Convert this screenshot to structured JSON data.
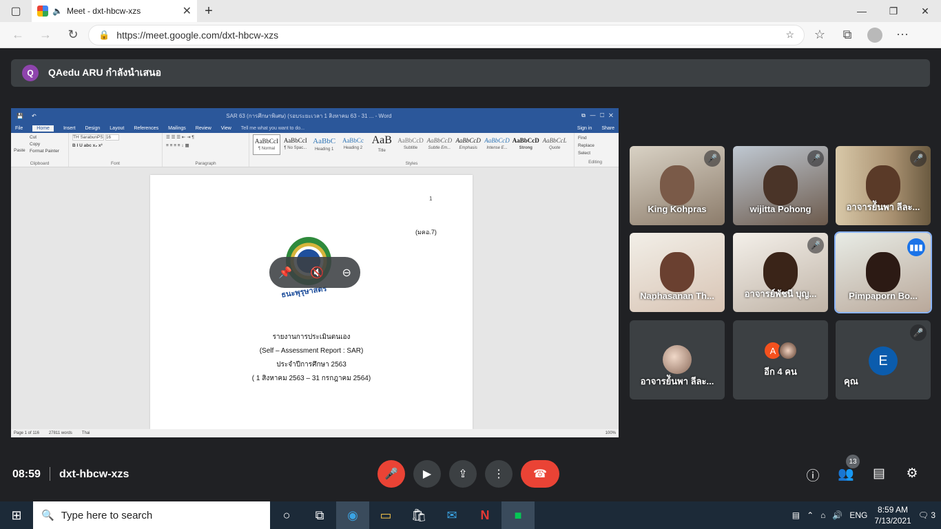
{
  "browser": {
    "tab_title": "Meet - dxt-hbcw-xzs",
    "url": "https://meet.google.com/dxt-hbcw-xzs"
  },
  "banner": {
    "avatar_letter": "Q",
    "text": "QAedu ARU กำลังนำเสนอ"
  },
  "word": {
    "title": "SAR 63 (การศึกษาพิเศษ) (รอบระยะเวลา 1 สิงหาคม 63 - 31 ... - Word",
    "tabs": [
      "File",
      "Home",
      "Insert",
      "Design",
      "Layout",
      "References",
      "Mailings",
      "Review",
      "View"
    ],
    "tell_me": "Tell me what you want to do...",
    "sign_in": "Sign in",
    "share": "Share",
    "clipboard": {
      "paste": "Paste",
      "cut": "Cut",
      "copy": "Copy",
      "format_painter": "Format Painter",
      "label": "Clipboard"
    },
    "font": {
      "name": "TH SarabunPS",
      "size": "16",
      "label": "Font"
    },
    "paragraph_label": "Paragraph",
    "styles": [
      {
        "preview": "AaBbCcI",
        "name": "¶ Normal"
      },
      {
        "preview": "AaBbCcI",
        "name": "¶ No Spac..."
      },
      {
        "preview": "AaBbC",
        "name": "Heading 1"
      },
      {
        "preview": "AaBbCc",
        "name": "Heading 2"
      },
      {
        "preview": "AaB",
        "name": "Title"
      },
      {
        "preview": "AaBbCcD",
        "name": "Subtitle"
      },
      {
        "preview": "AaBbCcD",
        "name": "Subtle Em..."
      },
      {
        "preview": "AaBbCcD",
        "name": "Emphasis"
      },
      {
        "preview": "AaBbCcD",
        "name": "Intense E..."
      },
      {
        "preview": "AaBbCcD",
        "name": "Strong"
      },
      {
        "preview": "AaBbCcL",
        "name": "Quote"
      }
    ],
    "styles_label": "Styles",
    "editing": {
      "find": "Find",
      "replace": "Replace",
      "select": "Select",
      "label": "Editing"
    },
    "page": {
      "page_number": "1",
      "ref": "(มคอ.7)",
      "seal_text": "ธนะพุรุษาสตร",
      "lines": [
        "รายงานการประเมินตนเอง",
        "(Self – Assessment Report : SAR)",
        "ประจำปีการศึกษา 2563",
        "( 1 สิงหาคม 2563 – 31 กรกฎาคม  2564)"
      ]
    },
    "status": {
      "page": "Page 1 of 116",
      "words": "27811 words",
      "lang": "Thai",
      "zoom": "100%"
    }
  },
  "participants": [
    {
      "name": "King Kohpras",
      "muted": true
    },
    {
      "name": "wijitta Pohong",
      "muted": true
    },
    {
      "name": "อาจารย์ันพา ลีละ...",
      "muted": true
    },
    {
      "name": "Naphasanan Th...",
      "muted": false
    },
    {
      "name": "อาจารย์พัชนี บุญ...",
      "muted": true
    },
    {
      "name": "Pimpaporn Bo...",
      "muted": false,
      "speaking": true
    },
    {
      "name": "อาจารย์ันพา ลีละ...",
      "muted": false
    },
    {
      "name": "อีก 4 คน",
      "avatar_letter": "A"
    },
    {
      "name": "คุณ",
      "avatar_letter": "E",
      "muted": true
    }
  ],
  "bottom": {
    "time": "08:59",
    "meeting_code": "dxt-hbcw-xzs",
    "people_count": "13"
  },
  "taskbar": {
    "search_placeholder": "Type here to search",
    "lang": "ENG",
    "time": "8:59 AM",
    "date": "7/13/2021",
    "notifications": "3"
  }
}
